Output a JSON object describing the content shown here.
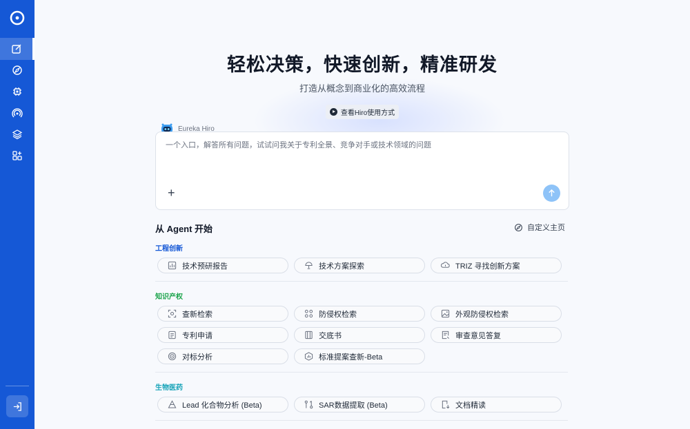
{
  "hero": {
    "title": "轻松决策，快速创新，精准研发",
    "subtitle": "打造从概念到商业化的高效流程",
    "video_label": "查看Hiro使用方式"
  },
  "chat": {
    "agent_name": "Eureka Hiro",
    "placeholder": "一个入口，解答所有问题，试试问我关于专利全景、竞争对手或技术领域的问题",
    "plus_label": "+"
  },
  "agents": {
    "title": "从 Agent 开始",
    "customize_label": "自定义主页",
    "categories": [
      {
        "label": "工程创新",
        "color": "#1558d6",
        "items": [
          {
            "label": "技术预研报告",
            "icon": "chart-report-icon"
          },
          {
            "label": "技术方案探索",
            "icon": "lamp-icon"
          },
          {
            "label": "TRIZ 寻找创新方案",
            "icon": "idea-cloud-icon"
          }
        ]
      },
      {
        "label": "知识产权",
        "color": "#1aa34a",
        "items": [
          {
            "label": "查新检索",
            "icon": "scan-icon"
          },
          {
            "label": "防侵权检索",
            "icon": "shield-nodes-icon"
          },
          {
            "label": "外观防侵权检索",
            "icon": "image-icon"
          },
          {
            "label": "专利申请",
            "icon": "document-icon"
          },
          {
            "label": "交底书",
            "icon": "book-icon"
          },
          {
            "label": "审查意见答复",
            "icon": "reply-doc-icon"
          },
          {
            "label": "对标分析",
            "icon": "target-icon"
          },
          {
            "label": "标准提案查新-Beta",
            "icon": "standard-chart-icon"
          }
        ]
      },
      {
        "label": "生物医药",
        "color": "#16a3b8",
        "items": [
          {
            "label": "Lead 化合物分析 (Beta)",
            "icon": "molecule-icon"
          },
          {
            "label": "SAR数据提取 (Beta)",
            "icon": "flow-icon"
          },
          {
            "label": "文档精读",
            "icon": "read-doc-icon"
          }
        ]
      }
    ]
  },
  "colors": {
    "sidebar": "#1558d6",
    "send_button": "#8ec3f8"
  }
}
